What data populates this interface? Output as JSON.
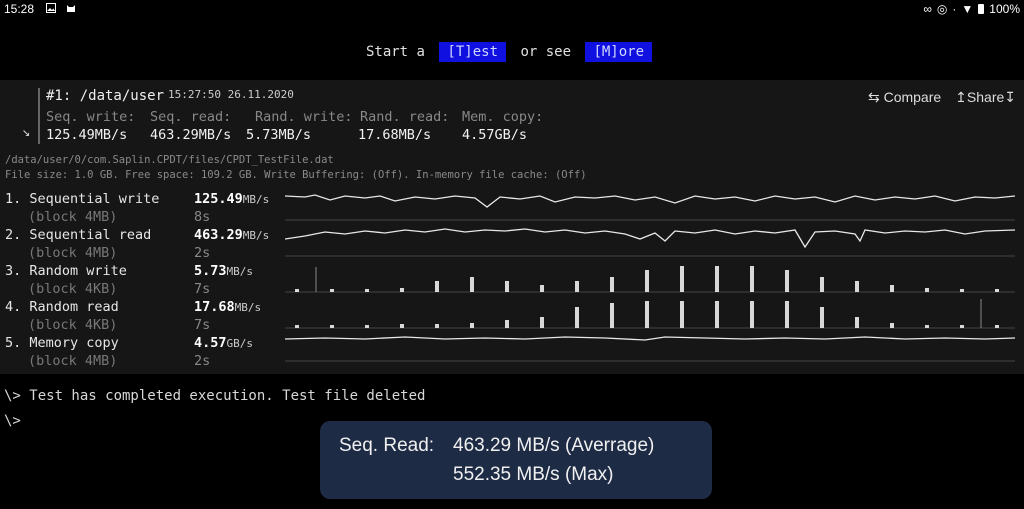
{
  "statusbar": {
    "time": "15:28",
    "battery": "100%"
  },
  "topbar": {
    "start_text": "Start a",
    "test_btn": "[T]est",
    "or_text": "or see",
    "more_btn": "[M]ore"
  },
  "result": {
    "title": "#1: /data/user",
    "timestamp": "15:27:50 26.11.2020",
    "compare": "⇆ Compare",
    "share": "↥Share↧",
    "labels": [
      "Seq. write:",
      "Seq. read:",
      "Rand. write:",
      "Rand. read:",
      "Mem. copy:"
    ],
    "values": [
      "125.49MB/s",
      "463.29MB/s",
      "5.73MB/s",
      "17.68MB/s",
      "4.57GB/s"
    ],
    "arrow": "↘"
  },
  "file": {
    "path": "/data/user/0/com.Saplin.CPDT/files/CPDT_TestFile.dat",
    "info": "File size: 1.0 GB. Free space: 109.2 GB. Write Buffering: (Off). In-memory file cache: (Off)"
  },
  "tests": [
    {
      "name": "1. Sequential write",
      "block": "(block 4MB)",
      "value": "125.49",
      "unit": "MB/s",
      "time": "8s"
    },
    {
      "name": "2. Sequential read",
      "block": "(block 4MB)",
      "value": "463.29",
      "unit": "MB/s",
      "time": "2s"
    },
    {
      "name": "3. Random write",
      "block": "(block 4KB)",
      "value": "5.73",
      "unit": "MB/s",
      "time": "7s"
    },
    {
      "name": "4. Random read",
      "block": "(block 4KB)",
      "value": "17.68",
      "unit": "MB/s",
      "time": "7s"
    },
    {
      "name": "5. Memory copy",
      "block": "(block 4MB)",
      "value": "4.57",
      "unit": "GB/s",
      "time": "2s"
    }
  ],
  "console": {
    "line1": "\\> Test has completed execution. Test file deleted",
    "line2": "\\>"
  },
  "tooltip": {
    "label": "Seq. Read:",
    "avg": "463.29 MB/s (Averrage)",
    "max": "552.35 MB/s (Max)"
  },
  "colors": {
    "button_bg": "#1010e0",
    "panel_bg": "#161616",
    "tooltip_bg": "#1d2b45"
  }
}
